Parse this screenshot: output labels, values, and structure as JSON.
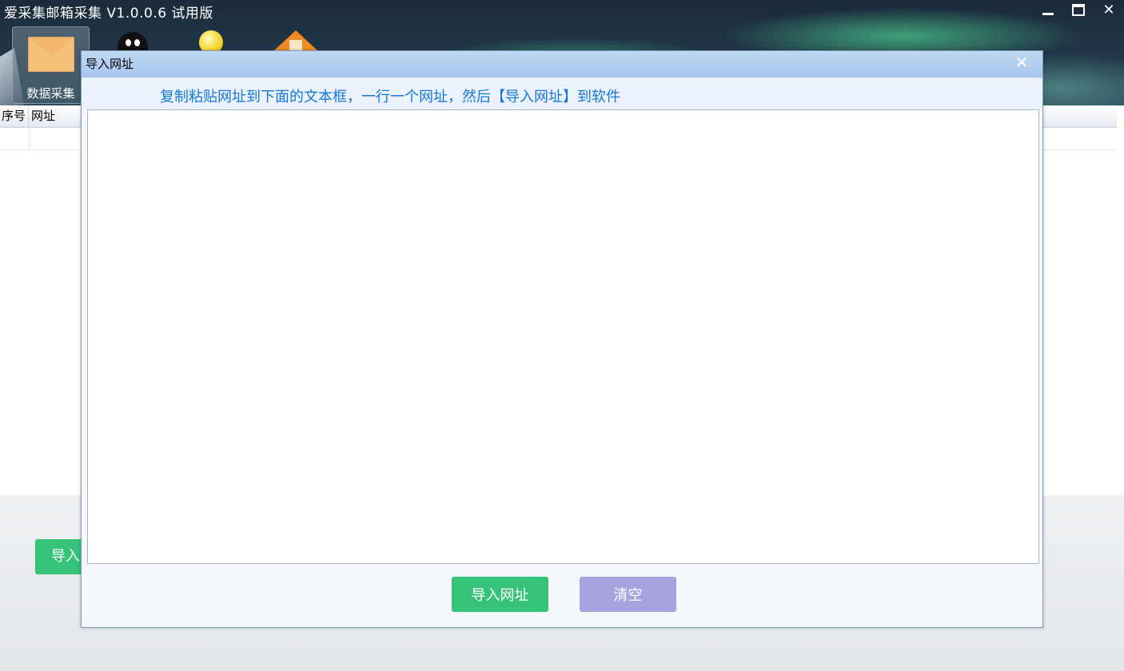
{
  "window": {
    "title": "爱采集邮箱采集 V1.0.0.6 试用版",
    "controls": {
      "minimize": "",
      "maximize": "",
      "close": "✕"
    }
  },
  "toolbar": {
    "items": [
      {
        "label": "数据采集",
        "icon": "envelope-icon"
      },
      {
        "icon": "penguin-icon"
      },
      {
        "icon": "lightbulb-icon"
      },
      {
        "icon": "home-icon"
      }
    ]
  },
  "table": {
    "columns": [
      "序号",
      "网址"
    ]
  },
  "background_button": {
    "label": "导入"
  },
  "dialog": {
    "title": "导入网址",
    "close_label": "✕",
    "instruction": "复制粘贴网址到下面的文本框，一行一个网址，然后【导入网址】到软件",
    "textarea_value": "",
    "import_button": "导入网址",
    "clear_button": "清空"
  },
  "colors": {
    "accent_green": "#36c378",
    "clear_purple": "#a8a3e0",
    "instruction_blue": "#1677d6",
    "dialog_titlebar": "#a7c7ee"
  }
}
